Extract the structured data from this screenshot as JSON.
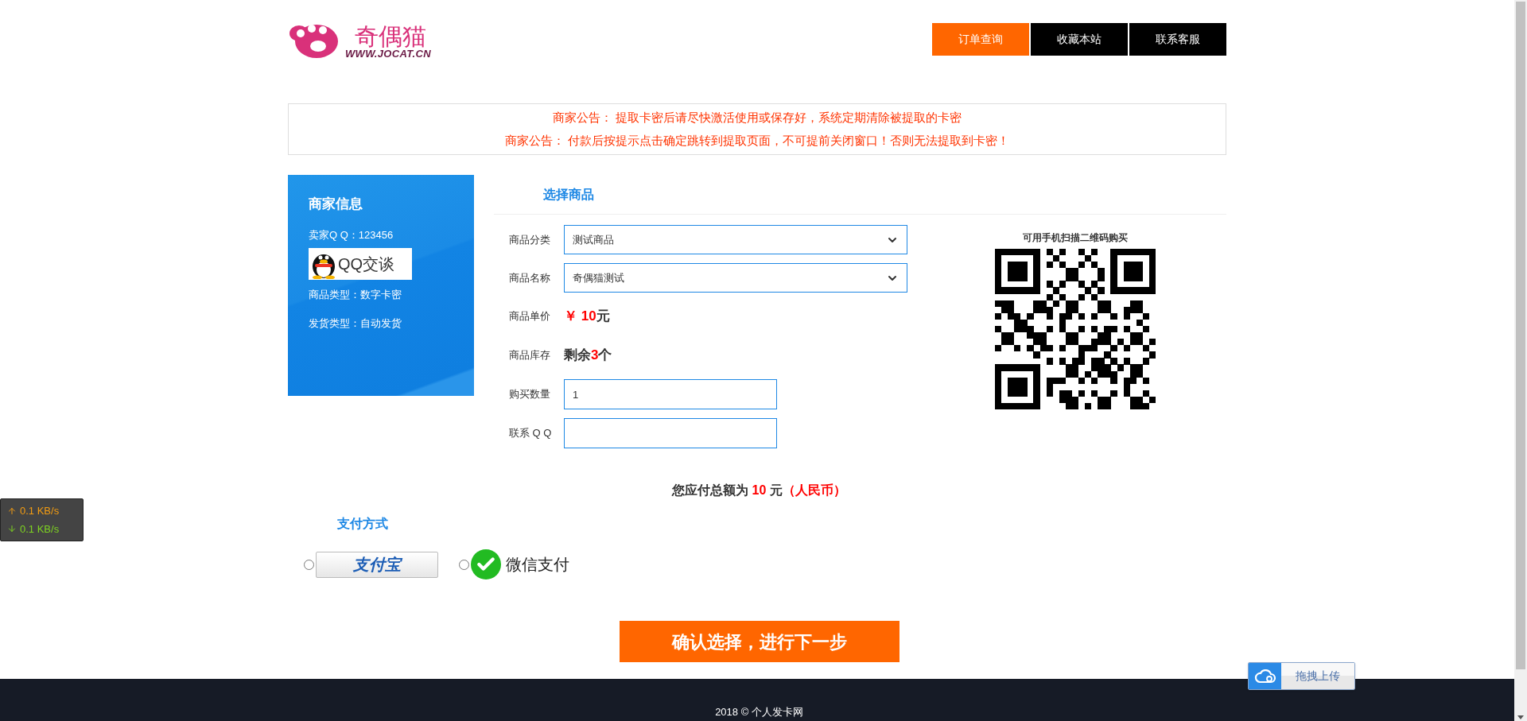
{
  "logo": {
    "name": "奇偶猫",
    "url": "WWW.JOCAT.CN"
  },
  "nav": [
    {
      "label": "订单查询",
      "selected": true
    },
    {
      "label": "收藏本站",
      "selected": false
    },
    {
      "label": "联系客服",
      "selected": false
    }
  ],
  "notices": [
    {
      "label": "商家公告：",
      "text": "提取卡密后请尽快激活使用或保存好，系统定期清除被提取的卡密"
    },
    {
      "label": "商家公告：",
      "text": "付款后按提示点击确定跳转到提取页面，不可提前关闭窗口！否则无法提取到卡密！"
    }
  ],
  "merchant": {
    "title": "商家信息",
    "seller_qq": "卖家Q Q：123456",
    "qq_button": "QQ交谈",
    "product_type": "商品类型：数字卡密",
    "delivery_type": "发货类型：自动发货"
  },
  "form": {
    "title": "选择商品",
    "category": {
      "label": "商品分类",
      "value": "测试商品"
    },
    "product": {
      "label": "商品名称",
      "value": "奇偶猫测试"
    },
    "price": {
      "label": "商品单价",
      "currency": "￥",
      "amount": "10",
      "unit": "元"
    },
    "stock": {
      "label": "商品库存",
      "prefix": "剩余",
      "count": "3",
      "unit": "个"
    },
    "quantity": {
      "label": "购买数量",
      "value": "1"
    },
    "contact": {
      "label": "联系 Q Q"
    }
  },
  "qr": {
    "caption": "可用手机扫描二维码购买"
  },
  "total": {
    "prefix": "您应付总额为",
    "amount": "10",
    "unit": "元",
    "currency": "（人民币）"
  },
  "payment": {
    "title": "支付方式",
    "options": [
      {
        "kind": "alipay",
        "label": "支付宝",
        "selected": false
      },
      {
        "kind": "wechat",
        "label": "微信支付",
        "selected": false
      }
    ]
  },
  "confirm_button": "确认选择，进行下一步",
  "footer": "2018 © 个人发卡网",
  "speed": {
    "up": "0.1 KB/s",
    "down": "0.1 KB/s"
  },
  "upload_widget": "拖拽上传"
}
